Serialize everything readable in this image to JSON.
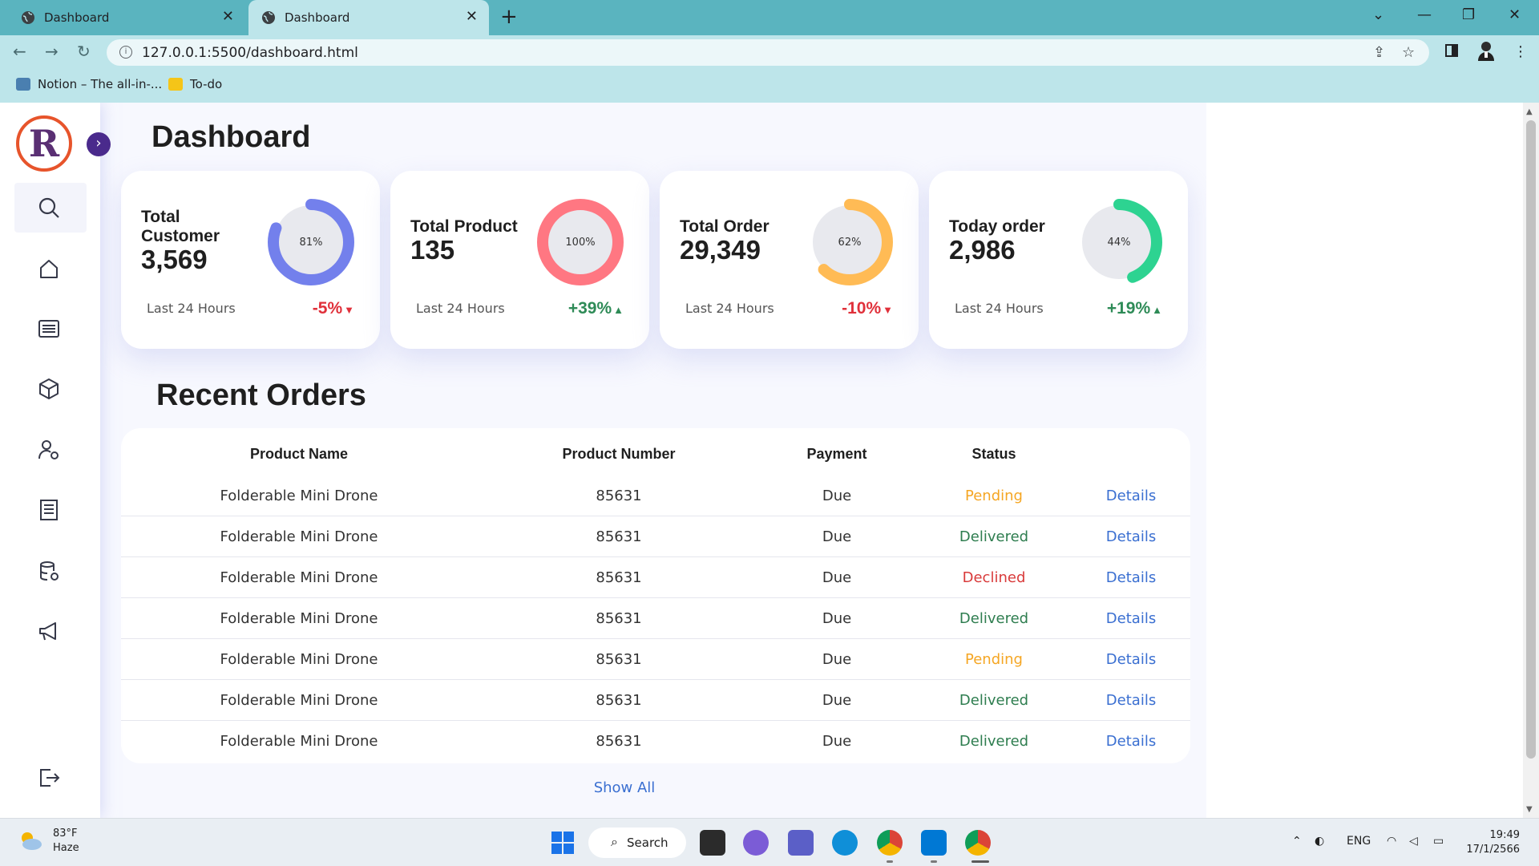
{
  "browser": {
    "tabs": [
      {
        "title": "Dashboard",
        "active": false
      },
      {
        "title": "Dashboard",
        "active": true
      }
    ],
    "new_tab": "+",
    "url": "127.0.0.1:5500/dashboard.html",
    "bookmarks": [
      {
        "label": "Notion – The all-in-...",
        "icon": "notion-icon"
      },
      {
        "label": "To-do",
        "icon": "todo-icon"
      }
    ]
  },
  "sidebar": {
    "logo_letter": "R",
    "items": [
      {
        "name": "search",
        "active": true
      },
      {
        "name": "home"
      },
      {
        "name": "list"
      },
      {
        "name": "package"
      },
      {
        "name": "user-settings"
      },
      {
        "name": "report"
      },
      {
        "name": "database"
      },
      {
        "name": "megaphone"
      }
    ],
    "logout": "logout-icon"
  },
  "dashboard": {
    "title": "Dashboard",
    "cards": [
      {
        "title_line1": "Total",
        "title_line2": "Customer",
        "value": "3,569",
        "percent": 81,
        "percent_label": "81%",
        "subtitle": "Last 24 Hours",
        "delta": "-5%",
        "direction": "down",
        "ring_color": "#7380ec"
      },
      {
        "title_line1": "Total Product",
        "title_line2": "",
        "value": "135",
        "percent": 100,
        "percent_label": "100%",
        "subtitle": "Last 24 Hours",
        "delta": "+39%",
        "direction": "up",
        "ring_color": "#ff7782"
      },
      {
        "title_line1": "Total Order",
        "title_line2": "",
        "value": "29,349",
        "percent": 62,
        "percent_label": "62%",
        "subtitle": "Last 24 Hours",
        "delta": "-10%",
        "direction": "down",
        "ring_color": "#ffbb55"
      },
      {
        "title_line1": "Today order",
        "title_line2": "",
        "value": "2,986",
        "percent": 44,
        "percent_label": "44%",
        "subtitle": "Last 24 Hours",
        "delta": "+19%",
        "direction": "up",
        "ring_color": "#2dd391"
      }
    ],
    "ring_track_color": "#e8e9ee",
    "up_color": "#2e8b57",
    "down_color": "#e0303a"
  },
  "orders": {
    "title": "Recent Orders",
    "columns": [
      "Product Name",
      "Product Number",
      "Payment",
      "Status"
    ],
    "rows": [
      {
        "product": "Folderable Mini Drone",
        "number": "85631",
        "payment": "Due",
        "status": "Pending",
        "action": "Details"
      },
      {
        "product": "Folderable Mini Drone",
        "number": "85631",
        "payment": "Due",
        "status": "Delivered",
        "action": "Details"
      },
      {
        "product": "Folderable Mini Drone",
        "number": "85631",
        "payment": "Due",
        "status": "Declined",
        "action": "Details"
      },
      {
        "product": "Folderable Mini Drone",
        "number": "85631",
        "payment": "Due",
        "status": "Delivered",
        "action": "Details"
      },
      {
        "product": "Folderable Mini Drone",
        "number": "85631",
        "payment": "Due",
        "status": "Pending",
        "action": "Details"
      },
      {
        "product": "Folderable Mini Drone",
        "number": "85631",
        "payment": "Due",
        "status": "Delivered",
        "action": "Details"
      },
      {
        "product": "Folderable Mini Drone",
        "number": "85631",
        "payment": "Due",
        "status": "Delivered",
        "action": "Details"
      }
    ],
    "show_all": "Show All",
    "status_colors": {
      "Pending": "#f5a623",
      "Delivered": "#2e7d4f",
      "Declined": "#d93a3a"
    }
  },
  "taskbar": {
    "weather_temp": "83°F",
    "weather_desc": "Haze",
    "search_label": "Search",
    "language": "ENG",
    "time": "19:49",
    "date": "17/1/2566"
  }
}
